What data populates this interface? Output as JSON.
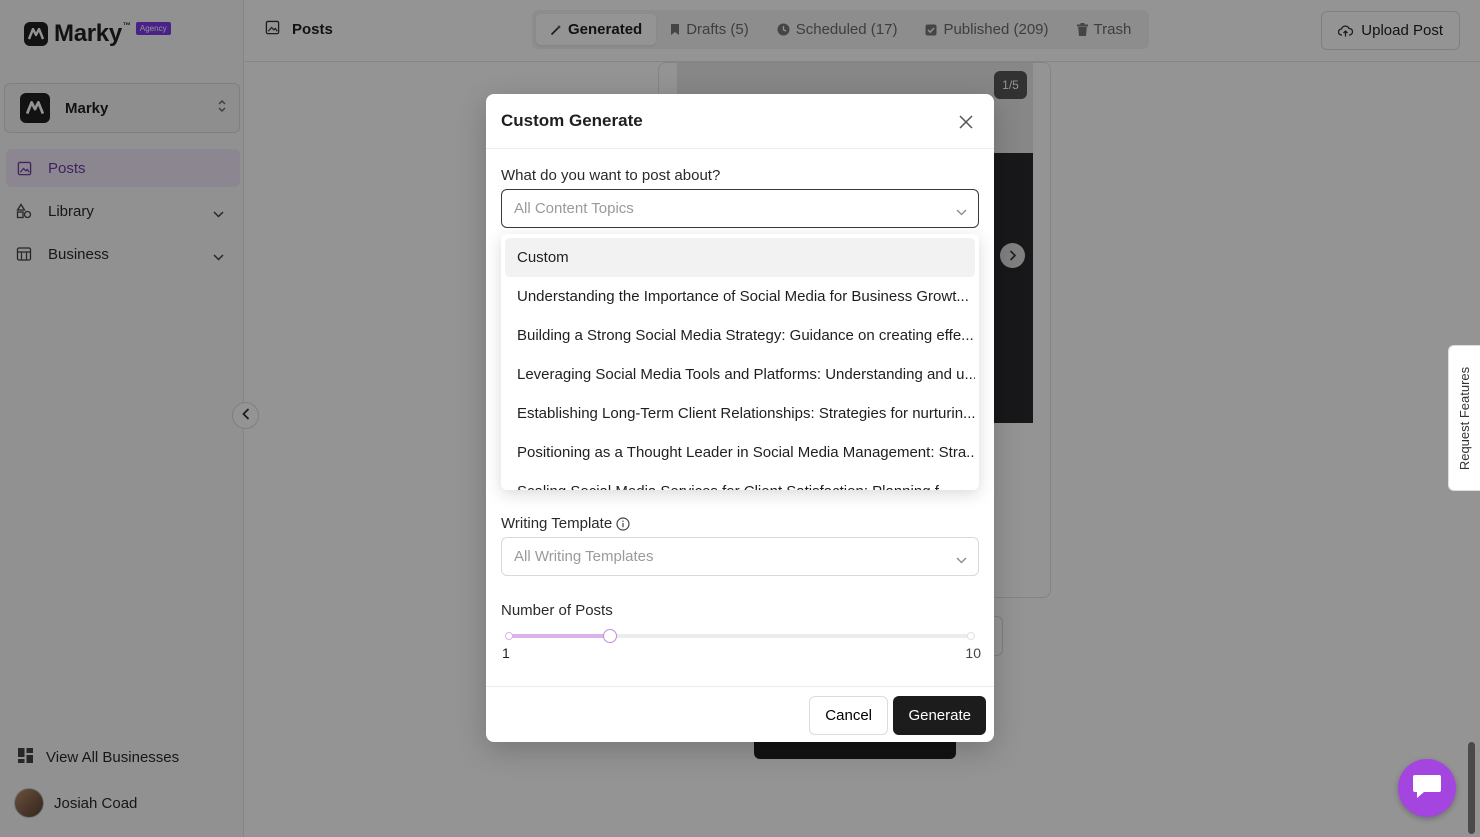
{
  "app": {
    "logo_text": "Marky",
    "logo_tm": "™",
    "agency_badge": "Agency"
  },
  "sidebar": {
    "business_name": "Marky",
    "items": [
      {
        "label": "Posts",
        "icon": "image-icon",
        "active": true
      },
      {
        "label": "Library",
        "icon": "shapes-icon",
        "active": false
      },
      {
        "label": "Business",
        "icon": "store-icon",
        "active": false
      }
    ],
    "view_all_label": "View All Businesses",
    "user_name": "Josiah Coad"
  },
  "header": {
    "page_title": "Posts",
    "tabs": [
      {
        "label": "Generated",
        "icon": "wand-icon",
        "active": true
      },
      {
        "label": "Drafts (5)",
        "icon": "bookmark-icon",
        "active": false
      },
      {
        "label": "Scheduled (17)",
        "icon": "clock-icon",
        "active": false
      },
      {
        "label": "Published (209)",
        "icon": "check-square-icon",
        "active": false
      },
      {
        "label": "Trash",
        "icon": "trash-icon",
        "active": false
      }
    ],
    "upload_label": "Upload Post"
  },
  "background": {
    "carousel_counter": "1/5"
  },
  "widgets": {
    "request_features_label": "Request Features"
  },
  "modal": {
    "title": "Custom Generate",
    "topic_label": "What do you want to post about?",
    "topic_placeholder": "All Content Topics",
    "topic_options": [
      "Custom",
      "Understanding the Importance of Social Media for Business Growt...",
      "Building a Strong Social Media Strategy: Guidance on creating effe...",
      "Leveraging Social Media Tools and Platforms: Understanding and u...",
      "Establishing Long-Term Client Relationships: Strategies for nurturin...",
      "Positioning as a Thought Leader in Social Media Management: Stra...",
      "Scaling Social Media Services for Client Satisfaction: Planning f..."
    ],
    "template_label": "Writing Template",
    "template_placeholder": "All Writing Templates",
    "posts_label": "Number of Posts",
    "slider_min": "1",
    "slider_max": "10",
    "slider_value": 3,
    "cancel_label": "Cancel",
    "generate_label": "Generate"
  },
  "colors": {
    "accent": "#7c3aed",
    "active_nav_bg": "#efe7f7",
    "active_nav_text": "#6d3fa6",
    "chat_bubble": "#a545e0",
    "primary_button": "#1c1c1c",
    "slider_fill": "#d9b3ea"
  }
}
